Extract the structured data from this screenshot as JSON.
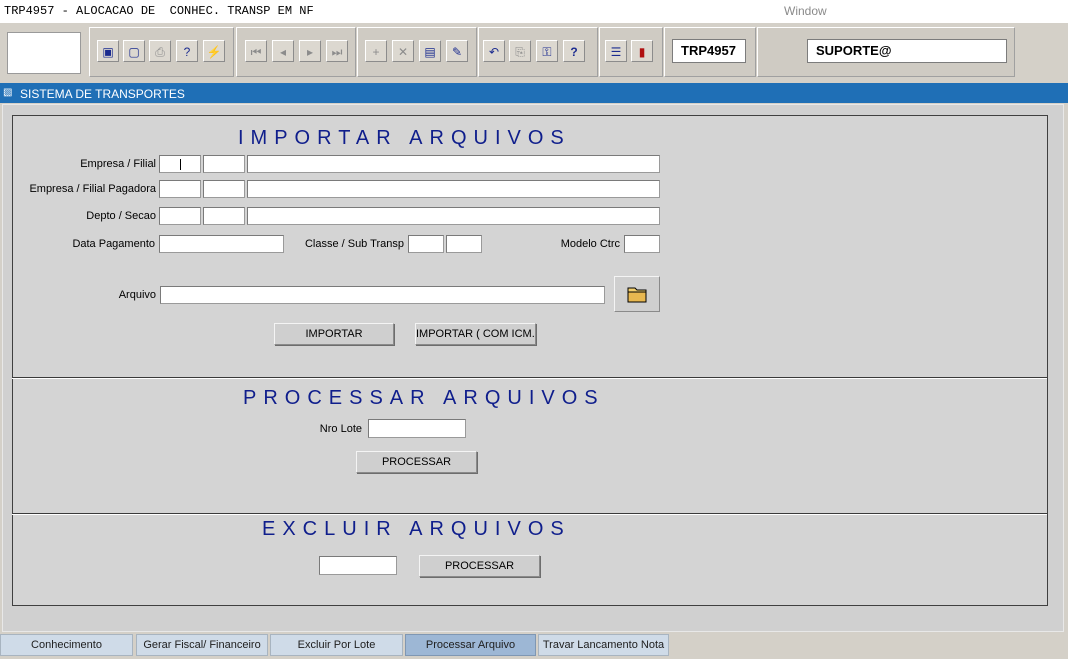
{
  "window": {
    "title": "TRP4957 - ALOCACAO DE  CONHEC. TRANSP EM NF",
    "menu_window": "Window"
  },
  "toolbar": {
    "program_code": "TRP4957",
    "user": "SUPORTE@",
    "buttons": [
      "save-icon",
      "window-icon",
      "print-icon",
      "help-query-icon",
      "execute-query-icon",
      "first-record-icon",
      "previous-record-icon",
      "next-record-icon",
      "last-record-icon",
      "insert-record-icon",
      "delete-record-icon",
      "duplicate-icon",
      "edit-icon",
      "undo-icon",
      "clipboard-icon",
      "key-icon",
      "help-icon",
      "menu-icon",
      "exit-icon"
    ]
  },
  "appbar": {
    "label": "SISTEMA DE TRANSPORTES"
  },
  "importar": {
    "title": "IMPORTAR ARQUIVOS",
    "empresa_filial": "Empresa / Filial",
    "empresa_filial_pagadora": "Empresa / Filial Pagadora",
    "depto_secao": "Depto / Secao",
    "data_pagamento": "Data Pagamento",
    "classe_sub_transp": "Classe / Sub Transp",
    "modelo_ctrc": "Modelo Ctrc",
    "arquivo": "Arquivo",
    "btn_importar": "IMPORTAR",
    "btn_importar_icms": "IMPORTAR ( COM ICM..."
  },
  "processar": {
    "title": "PROCESSAR ARQUIVOS",
    "nro_lote": "Nro Lote",
    "btn_processar": "PROCESSAR"
  },
  "excluir": {
    "title": "EXCLUIR ARQUIVOS",
    "btn_processar": "PROCESSAR"
  },
  "tabs": [
    {
      "label": "Conhecimento",
      "active": false
    },
    {
      "label": "Gerar Fiscal/ Financeiro",
      "active": false
    },
    {
      "label": "Excluir Por Lote",
      "active": false
    },
    {
      "label": "Processar Arquivo",
      "active": true
    },
    {
      "label": "Travar Lancamento Nota",
      "active": false
    }
  ],
  "colors": {
    "accent": "#1f6fb6",
    "section_title": "#0f1e8c",
    "active_tab": "#9db7d5"
  }
}
